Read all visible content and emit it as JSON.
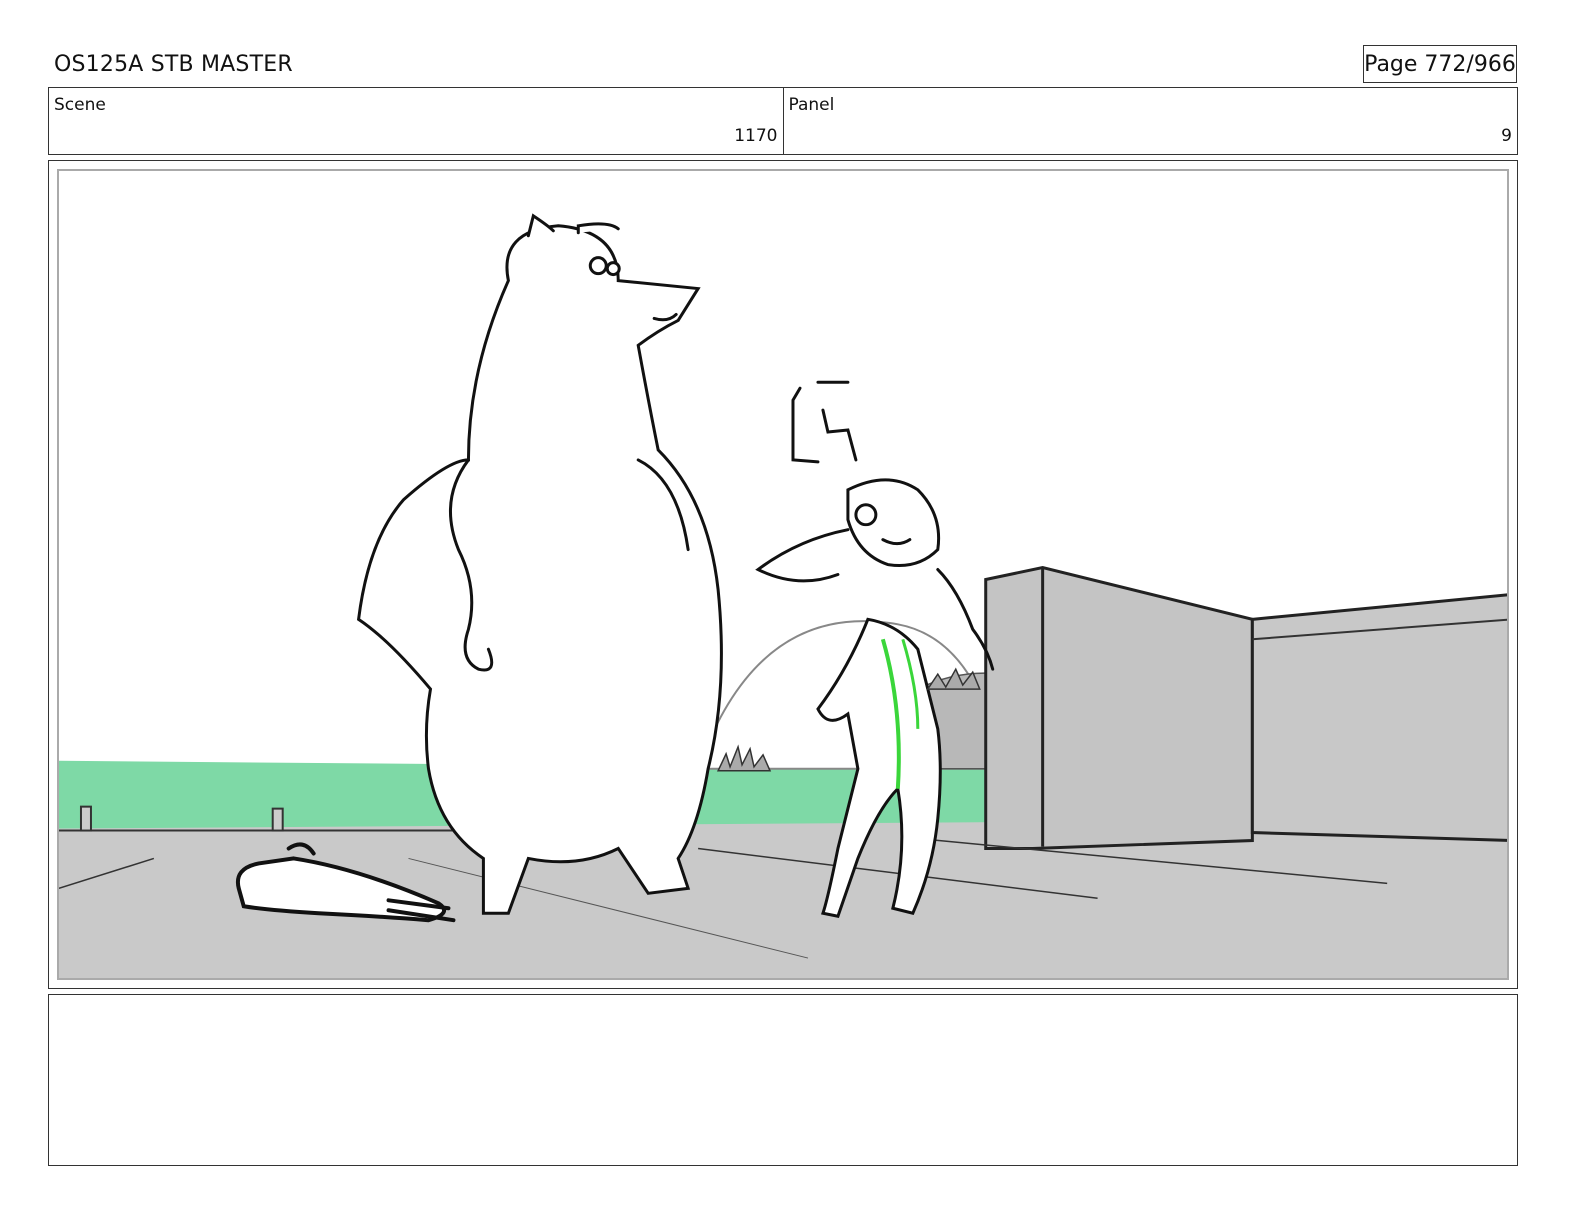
{
  "header": {
    "title": "OS125A STB MASTER",
    "page": "Page 772/966"
  },
  "info": {
    "scene_label": "Scene",
    "scene_value": "1170",
    "panel_label": "Panel",
    "panel_value": "9"
  },
  "panel_art": {
    "description_icon": "storyboard-sketch",
    "colors": {
      "ground": "#c9c9c9",
      "grass": "#7ed9a6",
      "wall": "#c4c4c4",
      "line": "#1a1a1a",
      "accent_green": "#3ad63a"
    }
  },
  "notes": {
    "text": ""
  }
}
